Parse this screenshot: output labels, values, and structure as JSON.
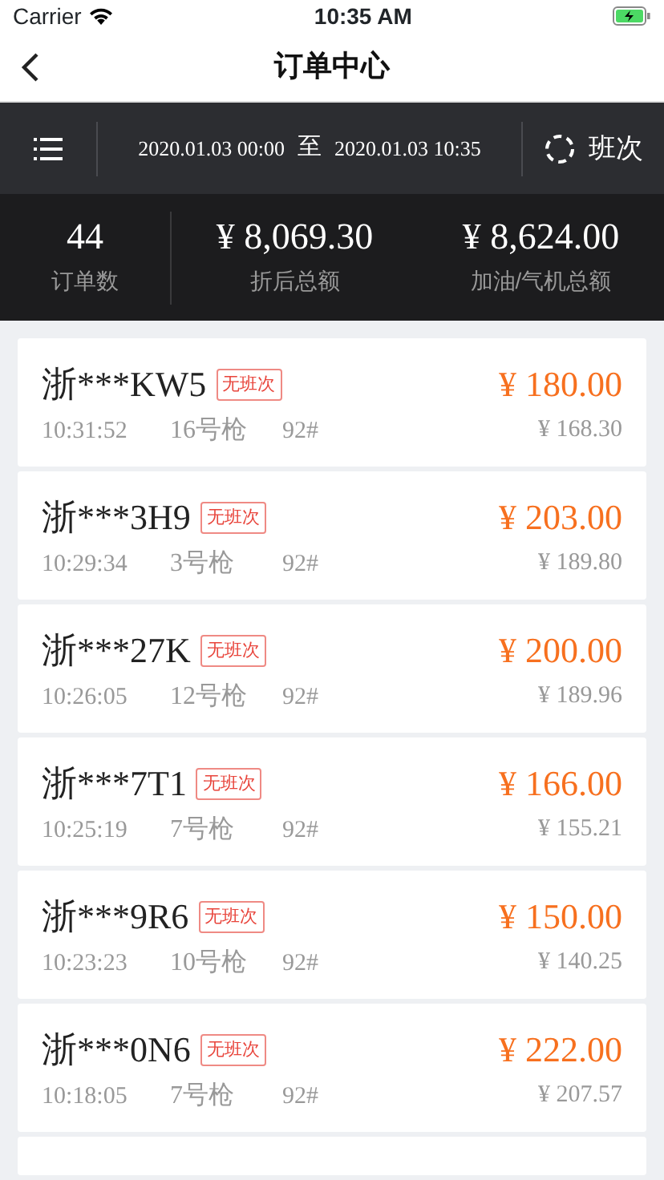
{
  "status_bar": {
    "carrier": "Carrier",
    "time": "10:35 AM"
  },
  "nav": {
    "title": "订单中心"
  },
  "filter": {
    "start": "2020.01.03 00:00",
    "separator": "至",
    "end": "2020.01.03 10:35",
    "shift_label": "班次"
  },
  "stats": [
    {
      "value": "44",
      "label": "订单数"
    },
    {
      "value": "¥ 8,069.30",
      "label": "折后总额"
    },
    {
      "value": "¥ 8,624.00",
      "label": "加油/气机总额"
    }
  ],
  "orders": [
    {
      "plate": "浙***KW5",
      "tag": "无班次",
      "time": "10:31:52",
      "gun": "16号枪",
      "fuel": "92#",
      "amount": "¥ 180.00",
      "paid": "¥ 168.30"
    },
    {
      "plate": "浙***3H9",
      "tag": "无班次",
      "time": "10:29:34",
      "gun": "3号枪",
      "fuel": "92#",
      "amount": "¥ 203.00",
      "paid": "¥ 189.80"
    },
    {
      "plate": "浙***27K",
      "tag": "无班次",
      "time": "10:26:05",
      "gun": "12号枪",
      "fuel": "92#",
      "amount": "¥ 200.00",
      "paid": "¥ 189.96"
    },
    {
      "plate": "浙***7T1",
      "tag": "无班次",
      "time": "10:25:19",
      "gun": "7号枪",
      "fuel": "92#",
      "amount": "¥ 166.00",
      "paid": "¥ 155.21"
    },
    {
      "plate": "浙***9R6",
      "tag": "无班次",
      "time": "10:23:23",
      "gun": "10号枪",
      "fuel": "92#",
      "amount": "¥ 150.00",
      "paid": "¥ 140.25"
    },
    {
      "plate": "浙***0N6",
      "tag": "无班次",
      "time": "10:18:05",
      "gun": "7号枪",
      "fuel": "92#",
      "amount": "¥ 222.00",
      "paid": "¥ 207.57"
    }
  ]
}
